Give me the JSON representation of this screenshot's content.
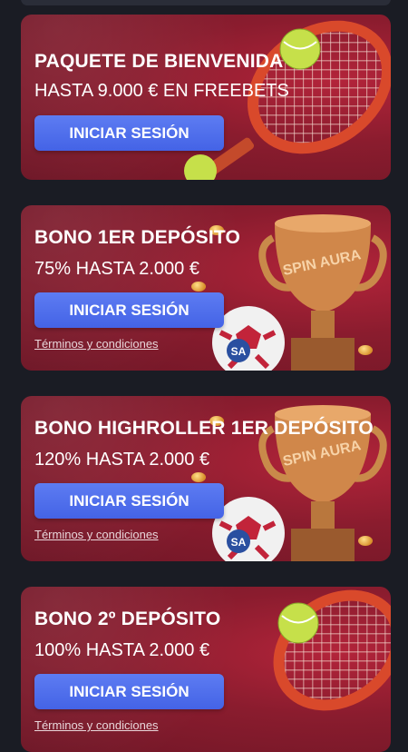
{
  "cards": [
    {
      "title": "PAQUETE DE BIENVENIDA",
      "subtitle": "HASTA 9.000 € EN FREEBETS",
      "button": "INICIAR SESIÓN",
      "art": "tennis-racket-icon"
    },
    {
      "title": "BONO 1ER DEPÓSITO",
      "subtitle": "75% HASTA 2.000 €",
      "button": "INICIAR SESIÓN",
      "terms": "Términos y condiciones",
      "art": "trophy-icon",
      "trophy_text": "SPIN AURA"
    },
    {
      "title": "BONO HIGHROLLER 1ER DEPÓSITO",
      "subtitle": "120% HASTA 2.000 €",
      "button": "INICIAR SESIÓN",
      "terms": "Términos y condiciones",
      "art": "trophy-icon",
      "trophy_text": "SPIN AURA"
    },
    {
      "title": "BONO 2º DEPÓSITO",
      "subtitle": "100% HASTA 2.000 €",
      "button": "INICIAR SESIÓN",
      "terms": "Términos y condiciones",
      "art": "tennis-racket-icon"
    }
  ],
  "colors": {
    "background": "#1a1c24",
    "card": "#8a1c2e",
    "button": "#4f6ff0"
  }
}
